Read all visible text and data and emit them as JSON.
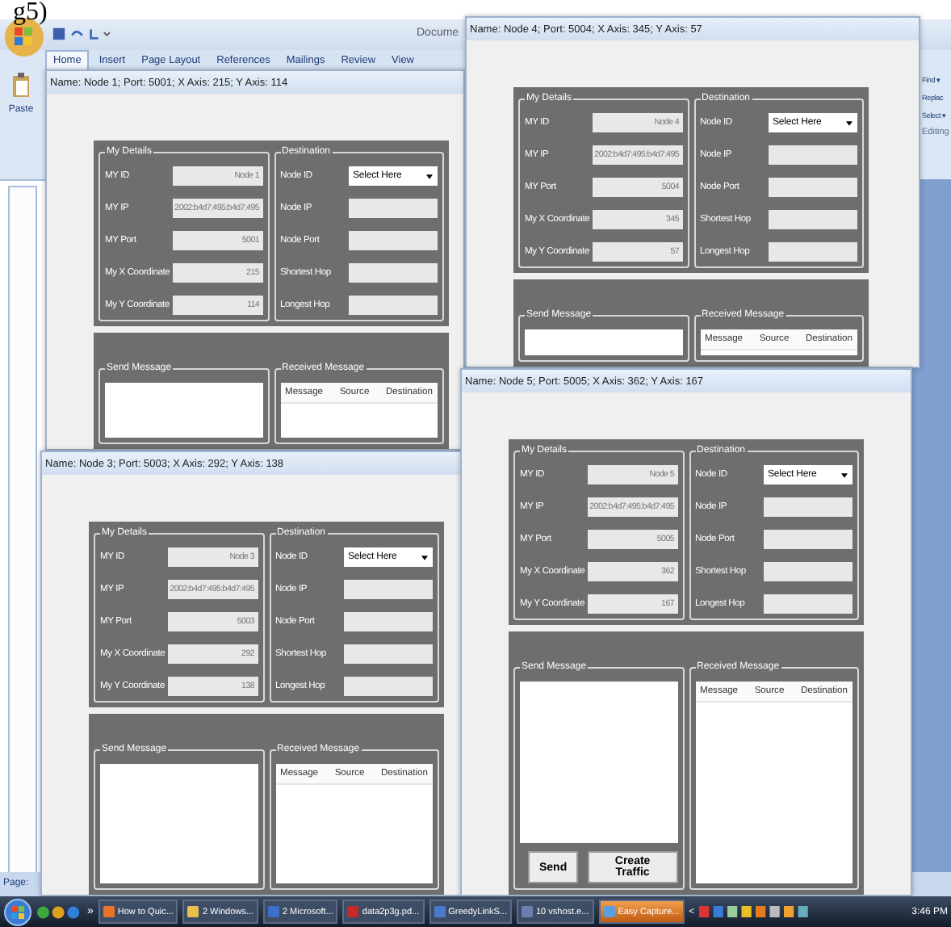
{
  "caption_fragment": "g5)",
  "word": {
    "title": "Docume",
    "tabs": [
      {
        "label": "Home",
        "selected": true
      },
      {
        "label": "Insert",
        "selected": false
      },
      {
        "label": "Page Layout",
        "selected": false
      },
      {
        "label": "References",
        "selected": false
      },
      {
        "label": "Mailings",
        "selected": false
      },
      {
        "label": "Review",
        "selected": false
      },
      {
        "label": "View",
        "selected": false
      }
    ],
    "paste": "Paste",
    "editing_commands": [
      "Find ▾",
      "Replac",
      "Select ▾"
    ],
    "editing_group": "Editing",
    "status": "Page:"
  },
  "windows": [
    {
      "title": "Name: Node 1; Port: 5001; X Axis: 215; Y Axis: 114",
      "details_legend": "My Details",
      "details": [
        {
          "label": "MY ID",
          "value": "Node 1"
        },
        {
          "label": "MY IP",
          "value": "2002:b4d7:495:b4d7:495"
        },
        {
          "label": "MY Port",
          "value": "5001"
        },
        {
          "label": "My X Coordinate",
          "value": "215"
        },
        {
          "label": "My Y Coordinate",
          "value": "114"
        }
      ],
      "destination_legend": "Destination",
      "destination": [
        {
          "label": "Node ID",
          "kind": "select",
          "value": "Select Here"
        },
        {
          "label": "Node IP",
          "kind": "text"
        },
        {
          "label": "Node Port",
          "kind": "text"
        },
        {
          "label": "Shortest Hop",
          "kind": "text"
        },
        {
          "label": "Longest Hop",
          "kind": "text"
        }
      ],
      "send_legend": "Send Message",
      "received_legend": "Received Message",
      "received_columns": [
        "Message",
        "Source",
        "Destination"
      ]
    },
    {
      "title": "Name: Node 4; Port: 5004; X Axis: 345; Y Axis: 57",
      "details_legend": "My Details",
      "details": [
        {
          "label": "MY ID",
          "value": "Node 4"
        },
        {
          "label": "MY IP",
          "value": "2002:b4d7:495:b4d7:495"
        },
        {
          "label": "MY Port",
          "value": "5004"
        },
        {
          "label": "My X Coordinate",
          "value": "345"
        },
        {
          "label": "My Y Coordinate",
          "value": "57"
        }
      ],
      "destination_legend": "Destination",
      "destination": [
        {
          "label": "Node ID",
          "kind": "select",
          "value": "Select Here"
        },
        {
          "label": "Node IP",
          "kind": "text"
        },
        {
          "label": "Node Port",
          "kind": "text"
        },
        {
          "label": "Shortest Hop",
          "kind": "text"
        },
        {
          "label": "Longest Hop",
          "kind": "text"
        }
      ],
      "send_legend": "Send Message",
      "received_legend": "Received Message",
      "received_columns": [
        "Message",
        "Source",
        "Destination"
      ]
    },
    {
      "title": "Name: Node 3; Port: 5003; X Axis: 292; Y Axis: 138",
      "details_legend": "My Details",
      "details": [
        {
          "label": "MY ID",
          "value": "Node 3"
        },
        {
          "label": "MY IP",
          "value": "2002:b4d7:495:b4d7:495"
        },
        {
          "label": "MY Port",
          "value": "5003"
        },
        {
          "label": "My X Coordinate",
          "value": "292"
        },
        {
          "label": "My Y Coordinate",
          "value": "138"
        }
      ],
      "destination_legend": "Destination",
      "destination": [
        {
          "label": "Node ID",
          "kind": "select",
          "value": "Select Here"
        },
        {
          "label": "Node IP",
          "kind": "text"
        },
        {
          "label": "Node Port",
          "kind": "text"
        },
        {
          "label": "Shortest Hop",
          "kind": "text"
        },
        {
          "label": "Longest Hop",
          "kind": "text"
        }
      ],
      "send_legend": "Send Message",
      "received_legend": "Received Message",
      "received_columns": [
        "Message",
        "Source",
        "Destination"
      ]
    },
    {
      "title": "Name: Node 5; Port: 5005; X Axis: 362; Y Axis: 167",
      "details_legend": "My Details",
      "details": [
        {
          "label": "MY ID",
          "value": "Node 5"
        },
        {
          "label": "MY IP",
          "value": "2002:b4d7:495:b4d7:495"
        },
        {
          "label": "MY Port",
          "value": "5005"
        },
        {
          "label": "My X Coordinate",
          "value": "362"
        },
        {
          "label": "My Y Coordinate",
          "value": "167"
        }
      ],
      "destination_legend": "Destination",
      "destination": [
        {
          "label": "Node ID",
          "kind": "select",
          "value": "Select Here"
        },
        {
          "label": "Node IP",
          "kind": "text"
        },
        {
          "label": "Node Port",
          "kind": "text"
        },
        {
          "label": "Shortest Hop",
          "kind": "text"
        },
        {
          "label": "Longest Hop",
          "kind": "text"
        }
      ],
      "send_legend": "Send Message",
      "received_legend": "Received Message",
      "received_columns": [
        "Message",
        "Source",
        "Destination"
      ],
      "buttons": [
        "Send",
        "Create Traffic"
      ]
    }
  ],
  "taskbar": {
    "overflow": "»",
    "tasks": [
      {
        "label": "How to Quic...",
        "selected": false
      },
      {
        "label": "2 Windows...",
        "selected": false
      },
      {
        "label": "2 Microsoft...",
        "selected": false
      },
      {
        "label": "data2p3g.pd...",
        "selected": false
      },
      {
        "label": "GreedyLinkS...",
        "selected": false
      },
      {
        "label": "10 vshost.e...",
        "selected": false
      },
      {
        "label": "Easy Capture...",
        "selected": true
      }
    ],
    "scroll": "<",
    "clock": "3:46 PM"
  }
}
